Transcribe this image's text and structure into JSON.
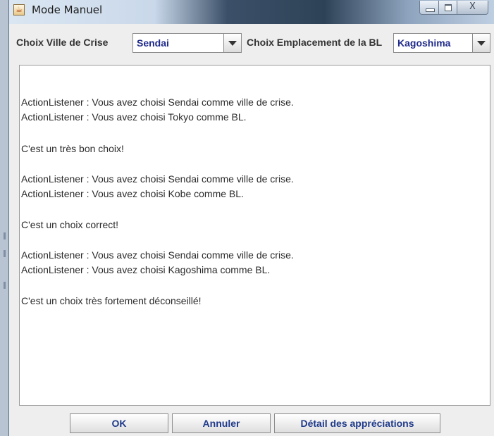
{
  "window": {
    "title": "Mode Manuel",
    "close_glyph": "X",
    "icon": "java-cup-icon"
  },
  "topbar": {
    "ville_label": "Choix Ville de Crise",
    "ville_value": "Sendai",
    "bl_label": "Choix Emplacement de la BL",
    "bl_value": "Kagoshima"
  },
  "log": {
    "lines": [
      "ActionListener : Vous avez choisi Sendai comme ville de crise.",
      "ActionListener : Vous avez choisi Tokyo comme BL.",
      "C'est un très bon choix!",
      "ActionListener : Vous avez choisi Sendai comme ville de crise.",
      "ActionListener : Vous avez choisi Kobe comme BL.",
      "C'est un choix correct!",
      "ActionListener : Vous avez choisi Sendai comme ville de crise.",
      "ActionListener : Vous avez choisi Kagoshima comme BL.",
      "C'est un choix très fortement déconseillé!"
    ]
  },
  "buttons": {
    "ok": "OK",
    "annuler": "Annuler",
    "detail": "Détail des appréciations"
  }
}
